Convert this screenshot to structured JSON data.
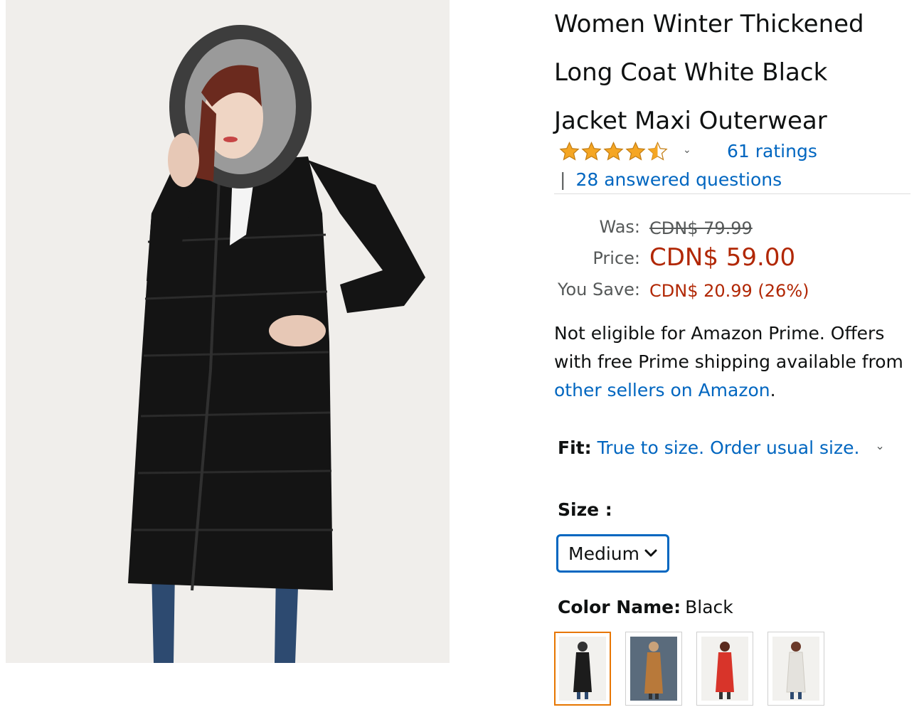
{
  "product": {
    "title_lines": [
      "Women Winter Thickened",
      "Long Coat White Black",
      "Jacket Maxi Outerwear"
    ],
    "image_alt": "woman wearing long black hooded puffer coat with fur trim",
    "rating": {
      "stars": 4.5,
      "chevron": "chevron-down-icon"
    },
    "ratings_link": "61 ratings",
    "qa_separator": "|",
    "qa_link": "28 answered questions"
  },
  "pricing": {
    "was_label": "Was:",
    "was_value": "CDN$ 79.99",
    "price_label": "Price:",
    "price_value": "CDN$ 59.00",
    "save_label": "You Save:",
    "save_value": "CDN$ 20.99 (26%)"
  },
  "prime": {
    "text": "Not eligible for Amazon Prime. Offers with free Prime shipping available from ",
    "link": "other sellers on Amazon",
    "tail": "."
  },
  "fit": {
    "label": "Fit:",
    "value": "True to size. Order usual size."
  },
  "size": {
    "label": "Size :",
    "selected": "Medium"
  },
  "color": {
    "label": "Color Name:",
    "value": "Black",
    "swatches": [
      {
        "name": "black",
        "color": "#1c1c1c",
        "selected": true
      },
      {
        "name": "camel",
        "color": "#b8793a",
        "selected": false
      },
      {
        "name": "red",
        "color": "#d8342a",
        "selected": false
      },
      {
        "name": "white",
        "color": "#ebe9e4",
        "selected": false
      }
    ]
  },
  "colors": {
    "link": "#0066c0",
    "price": "#b12704",
    "star": "#f5a623",
    "focus": "#0066c0",
    "swatch_selected_border": "#e77600"
  }
}
